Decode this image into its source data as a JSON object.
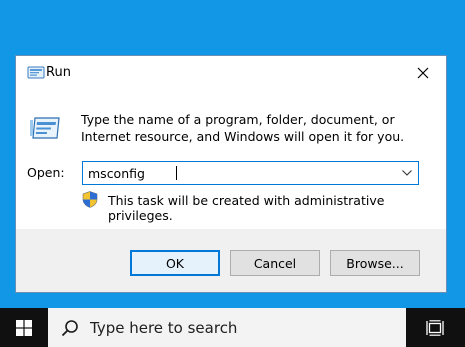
{
  "dialog": {
    "title": "Run",
    "description": "Type the name of a program, folder, document, or Internet resource, and Windows will open it for you.",
    "open_label": "Open:",
    "open_value": "msconfig",
    "admin_note": "This task will be created with administrative privileges.",
    "buttons": {
      "ok": "OK",
      "cancel": "Cancel",
      "browse": "Browse..."
    }
  },
  "taskbar": {
    "search_placeholder": "Type here to search"
  },
  "colors": {
    "desktop": "#1296e6",
    "accent": "#0078d7",
    "taskbar": "#101010"
  },
  "icons": [
    "run-icon",
    "close-icon",
    "run-large-icon",
    "chevron-down-icon",
    "shield-icon",
    "windows-logo-icon",
    "search-icon",
    "task-view-icon"
  ]
}
